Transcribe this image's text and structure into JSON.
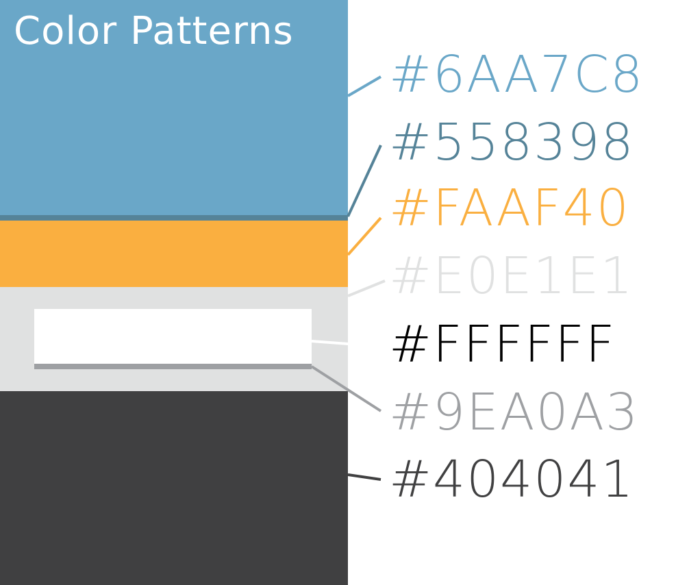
{
  "title": "Color Patterns",
  "colors": [
    {
      "hex_label": "#6AA7C8",
      "color": "#6AA7C8"
    },
    {
      "hex_label": "#558398",
      "color": "#558398"
    },
    {
      "hex_label": "#FAAF40",
      "color": "#FAAF40"
    },
    {
      "hex_label": "#E0E1E1",
      "color": "#E0E1E1"
    },
    {
      "hex_label": "#FFFFFF",
      "color": "#FFFFFF",
      "text_color": "#000000"
    },
    {
      "hex_label": "#9EA0A3",
      "color": "#9EA0A3"
    },
    {
      "hex_label": "#404041",
      "color": "#404041"
    }
  ]
}
